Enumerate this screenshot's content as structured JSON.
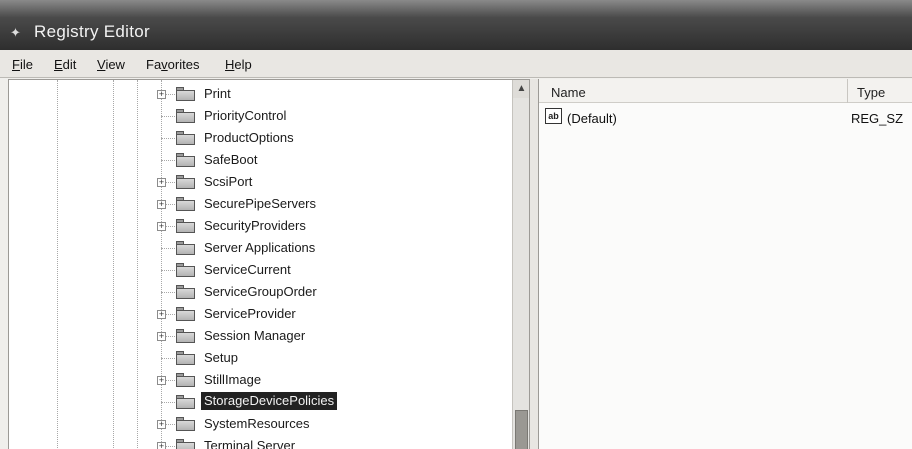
{
  "window": {
    "title": "Registry Editor",
    "icon": "registry-editor-icon"
  },
  "menu": [
    {
      "key": "File",
      "underline": "F",
      "rest": "ile"
    },
    {
      "key": "Edit",
      "underline": "E",
      "rest": "dit"
    },
    {
      "key": "View",
      "underline": "V",
      "rest": "iew"
    },
    {
      "key": "Favorites",
      "pre": "Fa",
      "underline": "v",
      "rest": "orites"
    },
    {
      "key": "Help",
      "underline": "H",
      "rest": "elp"
    }
  ],
  "tree": {
    "items": [
      {
        "label": "Print",
        "expandable": true,
        "selected": false
      },
      {
        "label": "PriorityControl",
        "expandable": false,
        "selected": false
      },
      {
        "label": "ProductOptions",
        "expandable": false,
        "selected": false
      },
      {
        "label": "SafeBoot",
        "expandable": false,
        "selected": false
      },
      {
        "label": "ScsiPort",
        "expandable": true,
        "selected": false
      },
      {
        "label": "SecurePipeServers",
        "expandable": true,
        "selected": false
      },
      {
        "label": "SecurityProviders",
        "expandable": true,
        "selected": false
      },
      {
        "label": "Server Applications",
        "expandable": false,
        "selected": false
      },
      {
        "label": "ServiceCurrent",
        "expandable": false,
        "selected": false
      },
      {
        "label": "ServiceGroupOrder",
        "expandable": false,
        "selected": false
      },
      {
        "label": "ServiceProvider",
        "expandable": true,
        "selected": false
      },
      {
        "label": "Session Manager",
        "expandable": true,
        "selected": false
      },
      {
        "label": "Setup",
        "expandable": false,
        "selected": false
      },
      {
        "label": "StillImage",
        "expandable": true,
        "selected": false
      },
      {
        "label": "StorageDevicePolicies",
        "expandable": false,
        "selected": true
      },
      {
        "label": "SystemResources",
        "expandable": true,
        "selected": false
      },
      {
        "label": "Terminal Server",
        "expandable": true,
        "selected": false
      }
    ]
  },
  "list": {
    "columns": {
      "name": "Name",
      "type": "Type"
    },
    "rows": [
      {
        "icon": "ab",
        "name": "(Default)",
        "type": "REG_SZ"
      }
    ]
  }
}
